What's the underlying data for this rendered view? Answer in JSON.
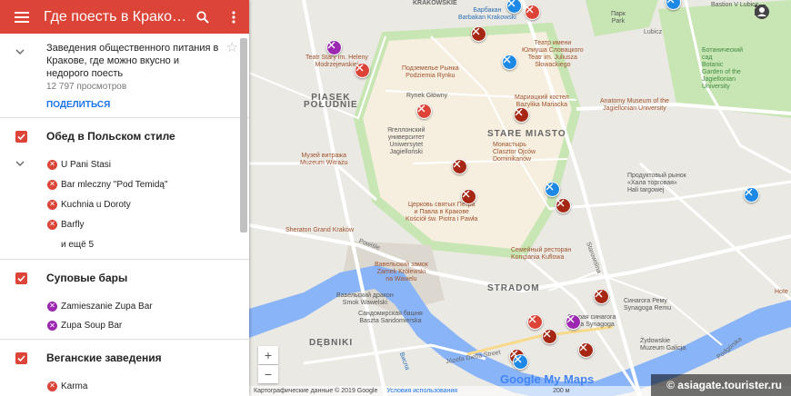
{
  "header": {
    "title": "Где поесть в Кракове ...",
    "menu_icon": "menu-icon",
    "search_icon": "search-icon",
    "more_icon": "more-vert-icon"
  },
  "info": {
    "description": "Заведения общественного питания в Кракове, где можно вкусно и недорого поесть",
    "views": "12 797 просмотров",
    "share": "ПОДЕЛИТЬСЯ"
  },
  "layers": [
    {
      "title": "Обед в Польском стиле",
      "color": "#db4437",
      "items": [
        "U Pani Stasi",
        "Bar mleczny \"Pod Temidą\"",
        "Kuchnia u Doroty",
        "Barfly"
      ],
      "more": "и ещё 5"
    },
    {
      "title": "Суповые бары",
      "color": "#9c27b0",
      "items": [
        "Zamieszanie Zupa Bar",
        "Zupa Soup Bar"
      ]
    },
    {
      "title": "Веганские заведения",
      "color": "#db4437",
      "items": [
        "Karma"
      ]
    }
  ],
  "map": {
    "labels": {
      "krakowskie": "KRAKOWSKIE",
      "barbakan": "Барбакан\nBarbakan Krakowski",
      "park": "Парк\nPark",
      "lubicz": "Lubicz",
      "bastion": "Bastion V Lubicz",
      "teatr": "Teatr Stary im. Heleny\nModrzejewskiej",
      "teatr_slowackiego": "Театр имени\nЮлиуша Словацкого\nTeatr im. Juliusza\nSłowackiego",
      "podziemia": "Подземелье Рынка\nPodziemia Rynku",
      "rynek": "Rynek Główny",
      "mariacki": "Мариацкий костел\nBazylika Mariacka",
      "anatomy": "Anatomy Museum of the\nJagiellonian University",
      "botanic": "Ботанический\nсад\nBotanic\nGarden of the\nJagiellonian\nUniversity",
      "piasek": "PIASEK\nPOŁUDNIE",
      "uni": "Ягеллонский\nуниверситет\nUniwersytet\nJagielloński",
      "stare_miasto": "STARE MIASTO",
      "monastyr": "Монастырь\nClasztor Ojców\nDominikanów",
      "witrazu": "Музей витража\nMuzeum Witrażu",
      "rynek_targowy": "Продуктовый рынок\n«Хала торговая»\nHali targowej",
      "kosciol": "Церковь святых Петра\nи Павла в Кракове\nKościół św. Piotra i Pawła",
      "sheraton": "Sheraton Grand Kraków",
      "semeynyi": "Семейный ресторан\nKompania Kuflowa",
      "wawel": "Вавельский замок\nZamek Królewski\nna Wawelu",
      "smok": "Вавельский дракон\nSmok Wawelski",
      "sandomierska": "Сандомирская башня\nBaszta Sandomierska",
      "stradom": "STRADOM",
      "synagoga": "Синагога Рему\nSynagoga Remu",
      "stara": "Старая синагога\nStara Synagoga",
      "zydowskie": "Żydowskie\nMuzeum Galicja",
      "debniki": "DĘBNIKI",
      "powisle": "Powiśle",
      "dietla": "Józefa Dietla Street",
      "starowislna": "Starowiślna",
      "podgorska": "Podgórska",
      "wisla": "Висла",
      "hotel": "Hote"
    },
    "zoom_in": "+",
    "zoom_out": "−",
    "attribution": "Картографические данные © 2019 Google",
    "terms": "Условия использования",
    "scale": "200 м",
    "google_logo": "Google My Maps",
    "watermark": "© asiagate.tourister.ru"
  },
  "colors": {
    "accent": "#db4437",
    "purple": "#9c27b0",
    "blue": "#1e88e5",
    "darkred": "#a52714",
    "park": "#c8e6b4",
    "water": "#8ab4f8",
    "old_town": "#f6efe0"
  }
}
